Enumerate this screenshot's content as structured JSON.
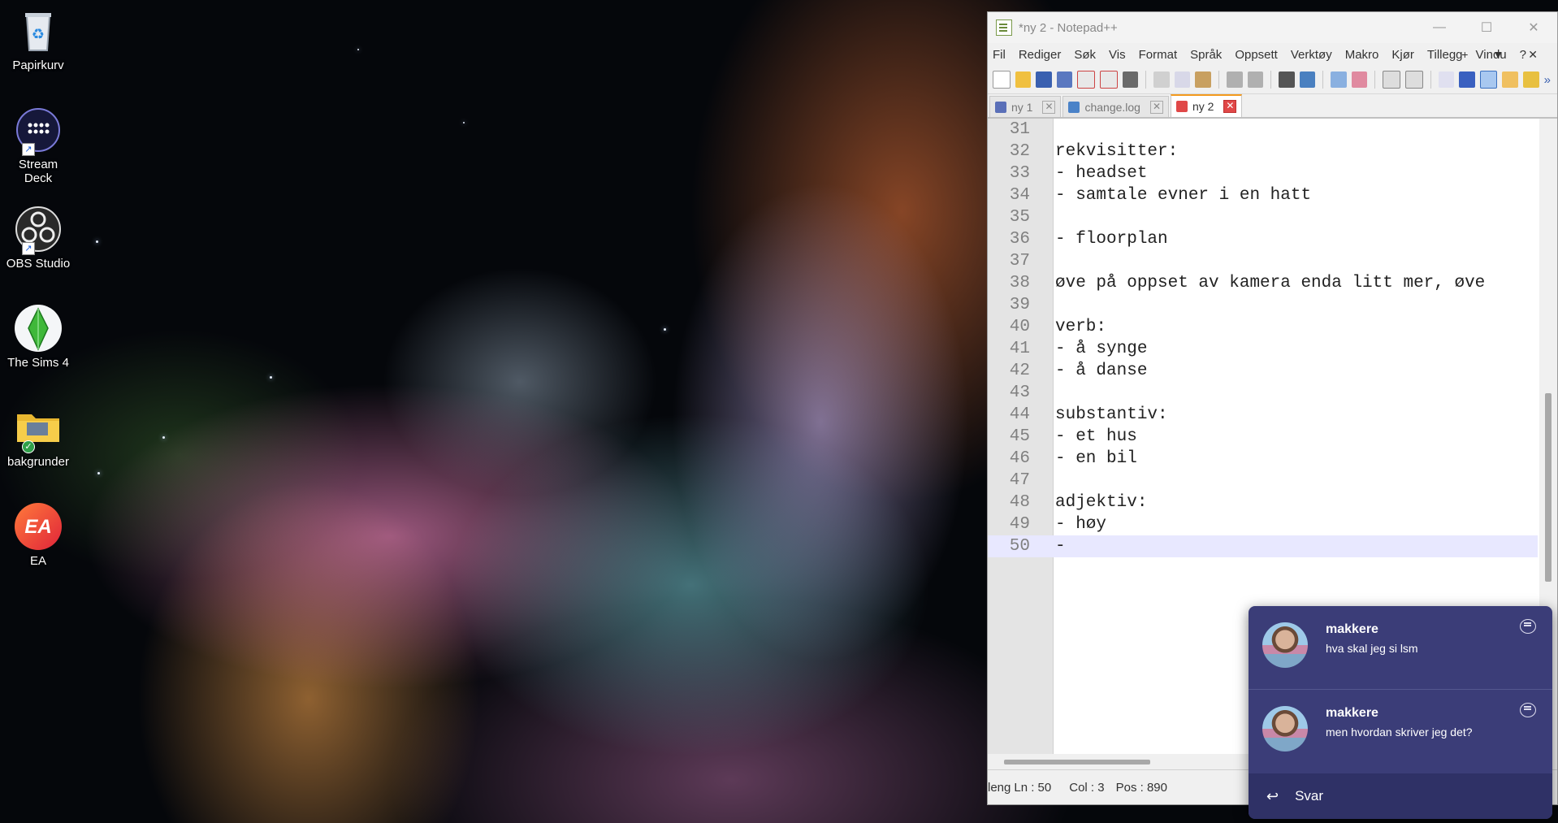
{
  "desktop": {
    "icons": [
      {
        "label": "Papirkurv",
        "icon": "recycle-bin-icon"
      },
      {
        "label": "Stream Deck",
        "icon": "stream-deck-icon"
      },
      {
        "label": "OBS Studio",
        "icon": "obs-icon"
      },
      {
        "label": "The Sims 4",
        "icon": "sims-plumbob-icon"
      },
      {
        "label": "bakgrunder",
        "icon": "folder-icon"
      },
      {
        "label": "EA",
        "icon": "ea-logo-icon"
      }
    ],
    "ea_logo_text": "EA"
  },
  "notepad": {
    "title": "*ny 2 - Notepad++",
    "window_buttons": {
      "minimize": "—",
      "maximize": "☐",
      "close": "✕"
    },
    "menu": [
      "Fil",
      "Rediger",
      "Søk",
      "Vis",
      "Format",
      "Språk",
      "Oppsett",
      "Verktøy",
      "Makro",
      "Kjør",
      "Tillegg",
      "Vindu",
      "?"
    ],
    "menu_right": [
      "+",
      "▼",
      "✕"
    ],
    "toolbar_overflow": "»",
    "tabs": [
      {
        "label": "ny 1",
        "close": "✕",
        "color": "#5a6fb8"
      },
      {
        "label": "change.log",
        "close": "✕",
        "color": "#4a82c8"
      },
      {
        "label": "ny 2",
        "close": "✕",
        "color": "#e04848"
      }
    ],
    "lines": [
      {
        "n": "31",
        "text": ""
      },
      {
        "n": "32",
        "text": "rekvisitter:"
      },
      {
        "n": "33",
        "text": "- headset"
      },
      {
        "n": "34",
        "text": "- samtale evner i en hatt"
      },
      {
        "n": "35",
        "text": ""
      },
      {
        "n": "36",
        "text": "- floorplan"
      },
      {
        "n": "37",
        "text": ""
      },
      {
        "n": "38",
        "text": "øve på oppset av kamera enda litt mer, øve"
      },
      {
        "n": "39",
        "text": ""
      },
      {
        "n": "40",
        "text": "verb:"
      },
      {
        "n": "41",
        "text": "- å synge"
      },
      {
        "n": "42",
        "text": "- å danse"
      },
      {
        "n": "43",
        "text": ""
      },
      {
        "n": "44",
        "text": "substantiv:"
      },
      {
        "n": "45",
        "text": "- et hus"
      },
      {
        "n": "46",
        "text": "- en bil"
      },
      {
        "n": "47",
        "text": ""
      },
      {
        "n": "48",
        "text": "adjektiv:"
      },
      {
        "n": "49",
        "text": "- høy"
      },
      {
        "n": "50",
        "text": "-"
      }
    ],
    "status": {
      "length": "leng",
      "ln": "Ln : 50",
      "col": "Col : 3",
      "pos": "Pos : 890"
    }
  },
  "notification": {
    "messages": [
      {
        "sender": "makkere",
        "text": "hva skal jeg si lsm"
      },
      {
        "sender": "makkere",
        "text": "men hvordan skriver jeg det?"
      }
    ],
    "reply_label": "Svar",
    "reply_icon": "↩"
  }
}
